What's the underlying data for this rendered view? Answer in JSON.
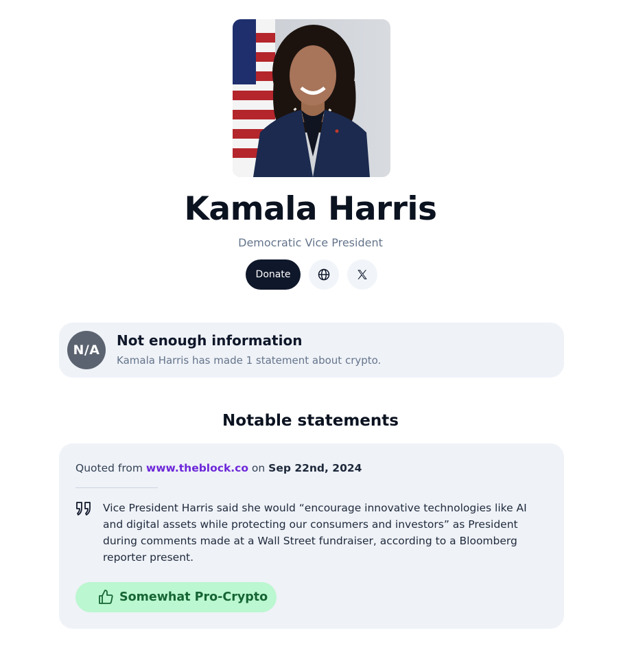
{
  "profile": {
    "name": "Kamala Harris",
    "role": "Democratic Vice President",
    "photo_icon": "portrait-photo"
  },
  "actions": {
    "donate_label": "Donate",
    "website_icon": "globe-icon",
    "x_icon": "x-logo-icon"
  },
  "rating": {
    "badge": "N/A",
    "title": "Not enough information",
    "subtitle": "Kamala Harris has made 1 statement about crypto.",
    "badge_color": "#5b6370"
  },
  "statements": {
    "section_title": "Notable statements",
    "items": [
      {
        "quoted_prefix": "Quoted from ",
        "source": "www.theblock.co",
        "on": " on ",
        "date": "Sep 22nd, 2024",
        "text": "Vice President Harris said she would “encourage innovative technologies like AI and digital assets while protecting our consumers and investors” as President during comments made at a Wall Street fundraiser, according to a Bloomberg reporter present.",
        "stance": "Somewhat Pro-Crypto",
        "stance_icon": "thumbs-up-icon",
        "stance_bg": "#bbf7d0",
        "stance_color": "#166534"
      }
    ]
  },
  "colors": {
    "link": "#6d28d9",
    "card_bg": "#eff2f7",
    "primary": "#0f172a"
  }
}
